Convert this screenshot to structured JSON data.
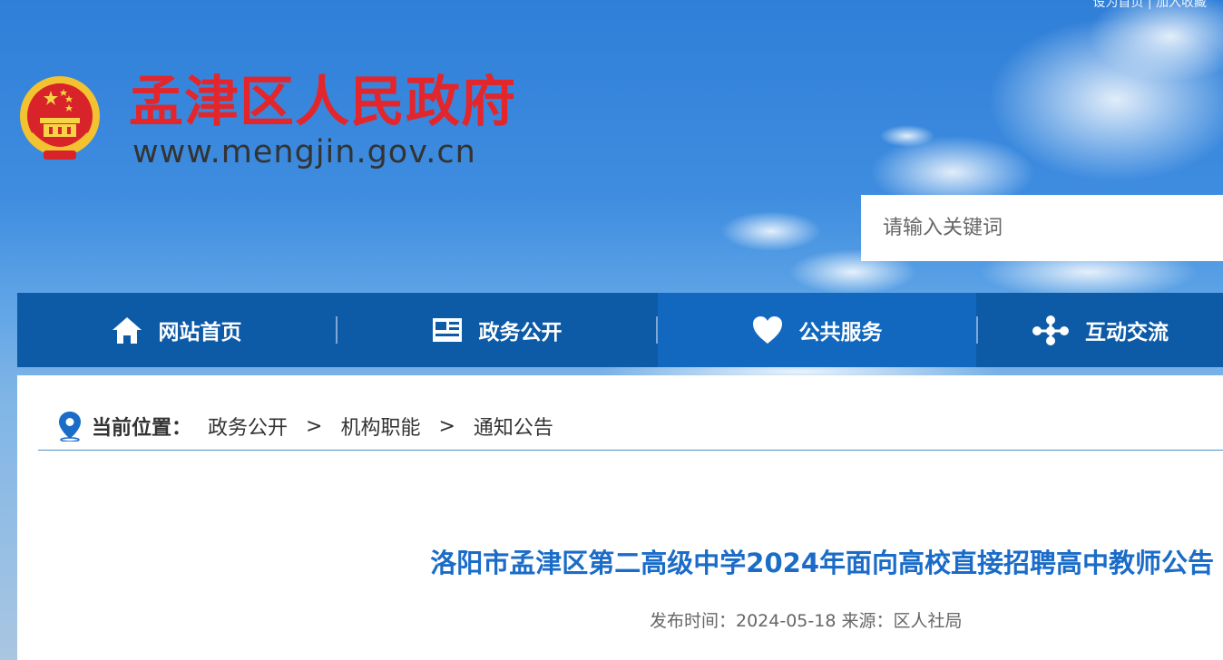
{
  "header": {
    "top_link": "设为首页 | 加入收藏",
    "site_title": "孟津区人民政府",
    "site_url": "www.mengjin.gov.cn",
    "emblem_icon": "national-emblem-icon"
  },
  "search": {
    "placeholder": "请输入关键词",
    "value": ""
  },
  "nav": {
    "items": [
      {
        "label": "网站首页",
        "icon": "home-icon",
        "active": false
      },
      {
        "label": "政务公开",
        "icon": "newspaper-icon",
        "active": false
      },
      {
        "label": "公共服务",
        "icon": "heart-icon",
        "active": true
      },
      {
        "label": "互动交流",
        "icon": "share-nodes-icon",
        "active": false
      }
    ]
  },
  "breadcrumb": {
    "label": "当前位置：",
    "items": [
      "政务公开",
      "机构职能",
      "通知公告"
    ],
    "separator": ">"
  },
  "article": {
    "title": "洛阳市孟津区第二高级中学2024年面向高校直接招聘高中教师公告",
    "meta": "发布时间：2024-05-18 来源：区人社局"
  },
  "colors": {
    "title_red": "#e3262c",
    "nav_blue": "#0d5aa7",
    "nav_active": "#1168be",
    "article_title_blue": "#1b6cc8"
  }
}
